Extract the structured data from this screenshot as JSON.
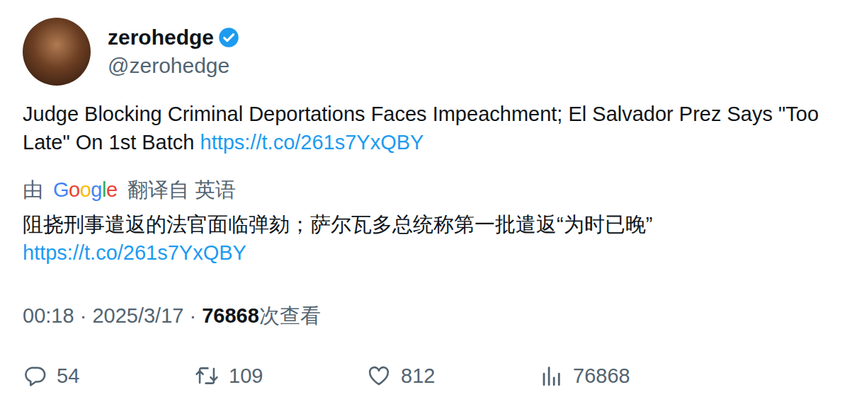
{
  "author": {
    "name": "zerohedge",
    "handle": "@zerohedge",
    "verified": true
  },
  "tweet": {
    "text": "Judge Blocking Criminal Deportations Faces Impeachment; El Salvador Prez Says \"Too Late\" On 1st Batch",
    "link": "https://t.co/261s7YxQBY"
  },
  "translation": {
    "prefix": "由",
    "google_letters": [
      {
        "char": "G",
        "color": "#4285f4"
      },
      {
        "char": "o",
        "color": "#ea4335"
      },
      {
        "char": "o",
        "color": "#fbbc05"
      },
      {
        "char": "g",
        "color": "#4285f4"
      },
      {
        "char": "l",
        "color": "#34a853"
      },
      {
        "char": "e",
        "color": "#ea4335"
      }
    ],
    "from_label": "翻译自",
    "language": "英语",
    "text": "阻挠刑事遣返的法官面临弹劾；萨尔瓦多总统称第一批遣返“为时已晚”",
    "link": "https://t.co/261s7YxQBY"
  },
  "meta": {
    "time": "00:18",
    "sep1": "·",
    "date": "2025/3/17",
    "sep2": "·",
    "views": "76868",
    "views_label": "次查看"
  },
  "stats": [
    {
      "kind": "reply",
      "count": "54"
    },
    {
      "kind": "retweet",
      "count": "109"
    },
    {
      "kind": "like",
      "count": "812"
    },
    {
      "kind": "views",
      "count": "76868"
    }
  ]
}
